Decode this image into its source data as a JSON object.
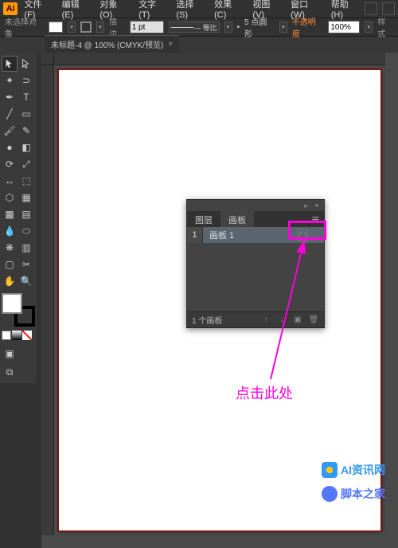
{
  "menubar": {
    "items": [
      "文件(F)",
      "编辑(E)",
      "对象(O)",
      "文字(T)",
      "选择(S)",
      "效果(C)",
      "视图(V)",
      "窗口(W)",
      "帮助(H)"
    ]
  },
  "controlbar": {
    "selection_status": "未选择对象",
    "stroke_label": "描边",
    "stroke_weight": "1 pt",
    "stroke_style": "— 等比",
    "brush_label": "5 点圆形",
    "opacity_label": "不透明度",
    "opacity_value": "100%",
    "style_label": "样式"
  },
  "doc_tab": {
    "title": "未标题-4 @ 100% (CMYK/预览)"
  },
  "panel": {
    "tabs": [
      "图层",
      "画板"
    ],
    "row_num": "1",
    "row_label": "画板 1",
    "footer_text": "1 个画板"
  },
  "annotation": {
    "text": "点击此处"
  },
  "watermarks": {
    "wm1": "AI资讯网",
    "wm2": "脚本之家"
  }
}
